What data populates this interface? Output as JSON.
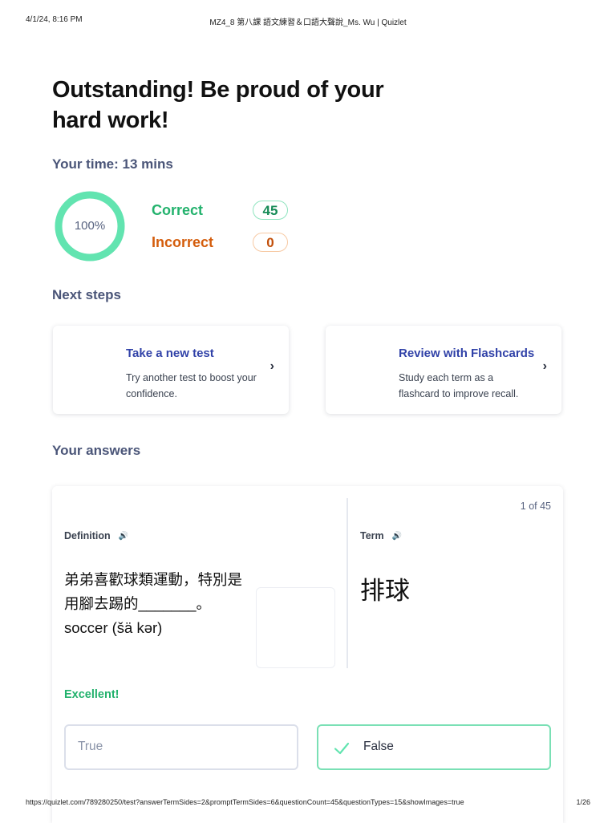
{
  "print_header": {
    "date": "4/1/24, 8:16 PM",
    "title": "MZ4_8 第八課 語文練習＆口語大聲說_Ms. Wu | Quizlet"
  },
  "print_footer": {
    "url": "https://quizlet.com/789280250/test?answerTermSides=2&promptTermSides=6&questionCount=45&questionTypes=15&showImages=true",
    "page": "1/26"
  },
  "result": {
    "headline": "Outstanding! Be proud of your hard work!",
    "time": "Your time: 13 mins",
    "score_label": "100%",
    "score_fraction": 1.0,
    "correct_label": "Correct",
    "correct_count": "45",
    "incorrect_label": "Incorrect",
    "incorrect_count": "0"
  },
  "next_steps": {
    "title": "Next steps",
    "cards": [
      {
        "title": "Take a new test",
        "description": "Try another test to boost your confidence."
      },
      {
        "title": "Review with Flashcards",
        "description": "Study each term as a flashcard to improve recall."
      }
    ]
  },
  "answers": {
    "title": "Your answers",
    "counter": "1 of 45",
    "definition_label": "Definition",
    "term_label": "Term",
    "definition_text": "弟弟喜歡球類運動，特別是\n用腳去踢的_______。\nsoccer (šä kər)",
    "term_text": "排球",
    "feedback": "Excellent!",
    "options": [
      "True",
      "False"
    ],
    "selected_option": "False"
  },
  "colors": {
    "correct": "#23b26d",
    "incorrect": "#d45d0c",
    "ring": "#62e4b0",
    "link": "#3142a8"
  },
  "icons": [
    "speaker-icon",
    "chevron-right-icon",
    "check-icon"
  ]
}
